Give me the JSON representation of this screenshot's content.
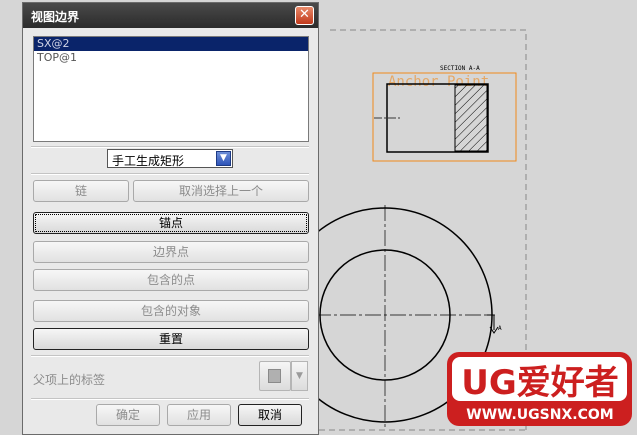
{
  "dialog": {
    "title": "视图边界",
    "close_glyph": "✕",
    "list_items": [
      "SX@2",
      "TOP@1"
    ],
    "selected_index": 0,
    "boundary_type": "手工生成矩形",
    "buttons": {
      "chain": "链",
      "deselect_last": "取消选择上一个",
      "anchor_point": "锚点",
      "boundary_point": "边界点",
      "included_point": "包含的点",
      "included_object": "包含的对象",
      "reset": "重置"
    },
    "parent_label": "父项上的标签",
    "footer": {
      "ok": "确定",
      "apply": "应用",
      "cancel": "取消"
    }
  },
  "drawing": {
    "section_label": "SECTION A-A",
    "anchor_label": "Anchor Point",
    "section_mark": "A"
  },
  "watermark": {
    "brand": "UG爱好者",
    "url": "WWW.UGSNX.COM"
  },
  "colors": {
    "anchor_orange": "#f08a1c",
    "watermark_red": "#cc1f1f"
  }
}
